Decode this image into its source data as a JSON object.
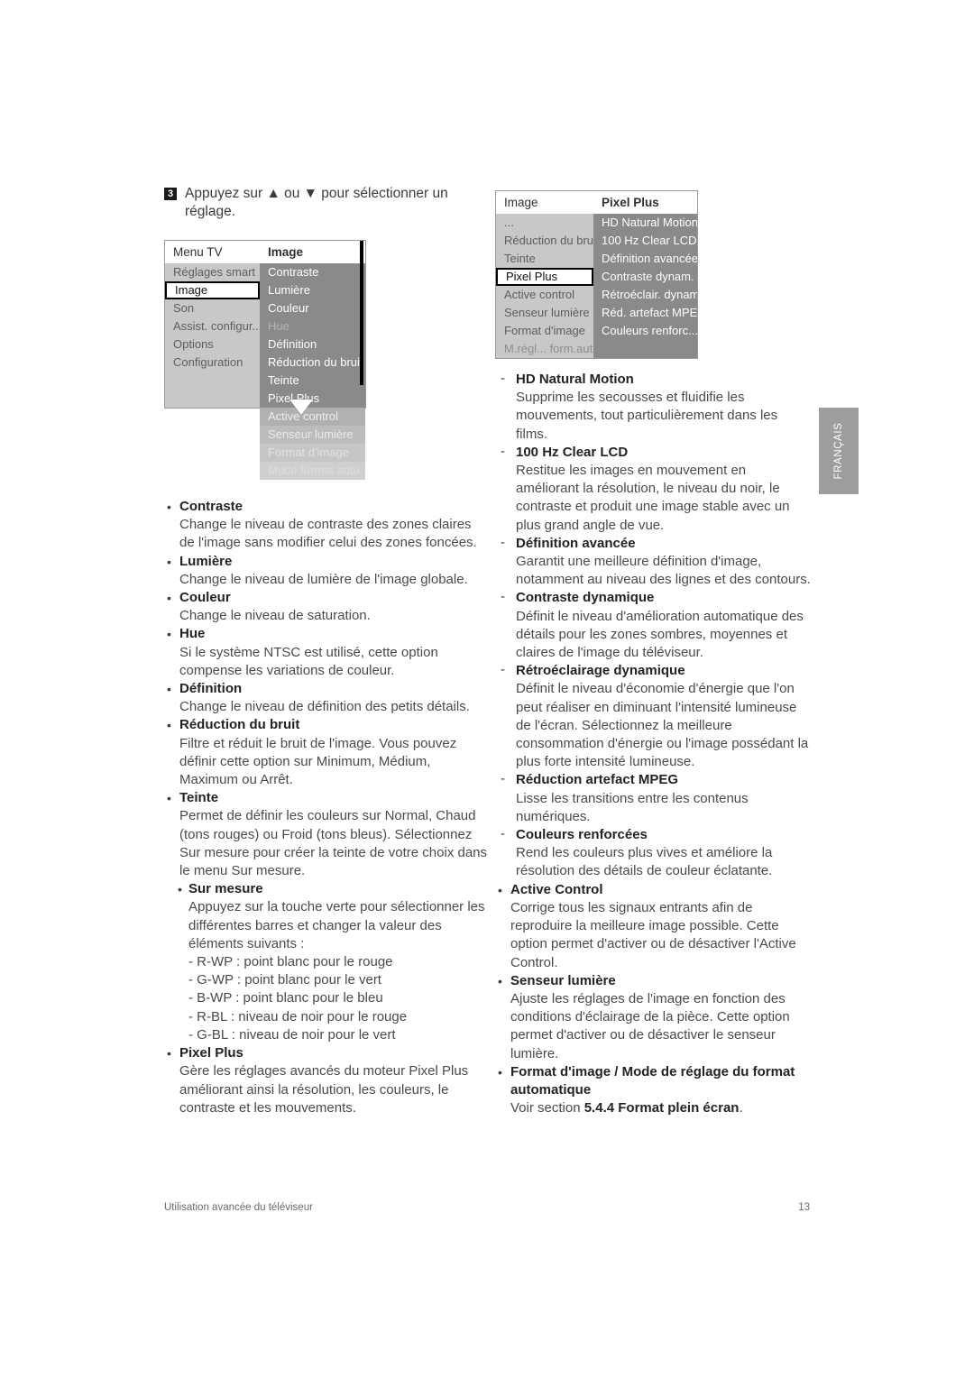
{
  "step": {
    "number": "3",
    "text": "Appuyez sur ▲ ou ▼ pour sélectionner un réglage."
  },
  "menu_tv": {
    "header_left": "Menu TV",
    "header_right": "Image",
    "left_items": [
      {
        "label": "Réglages smart",
        "state": "normal"
      },
      {
        "label": "Image",
        "state": "selected"
      },
      {
        "label": "Son",
        "state": "normal"
      },
      {
        "label": "Assist. configur...",
        "state": "normal"
      },
      {
        "label": "Options",
        "state": "normal"
      },
      {
        "label": "Configuration",
        "state": "normal"
      },
      {
        "label": "",
        "state": "blank"
      },
      {
        "label": "",
        "state": "blank"
      }
    ],
    "right_items": [
      {
        "label": "Contraste",
        "state": "normal"
      },
      {
        "label": "Lumière",
        "state": "normal"
      },
      {
        "label": "Couleur",
        "state": "normal"
      },
      {
        "label": "Hue",
        "state": "dim"
      },
      {
        "label": "Définition",
        "state": "normal"
      },
      {
        "label": "Réduction du bruit",
        "state": "normal"
      },
      {
        "label": "Teinte",
        "state": "normal"
      },
      {
        "label": "Pixel Plus",
        "state": "normal"
      },
      {
        "label": "Active control",
        "state": "fade1"
      },
      {
        "label": "Senseur lumière",
        "state": "fade2"
      },
      {
        "label": "Format d'image",
        "state": "fade3"
      },
      {
        "label": "Mode format auto...",
        "state": "fade4"
      }
    ]
  },
  "menu_pixelplus": {
    "header_left": "Image",
    "header_right": "Pixel Plus",
    "left_items": [
      {
        "label": "...",
        "state": "normal"
      },
      {
        "label": "Réduction du bruit",
        "state": "normal"
      },
      {
        "label": "Teinte",
        "state": "normal"
      },
      {
        "label": "Pixel Plus",
        "state": "selected"
      },
      {
        "label": "Active control",
        "state": "normal"
      },
      {
        "label": "Senseur lumière",
        "state": "normal"
      },
      {
        "label": "Format d'image",
        "state": "normal"
      },
      {
        "label": "M.régl... form.auto...",
        "state": "dim"
      }
    ],
    "right_items": [
      {
        "label": "HD Natural Motion",
        "state": "normal"
      },
      {
        "label": "100 Hz Clear LCD",
        "state": "normal"
      },
      {
        "label": "Définition avancée",
        "state": "normal"
      },
      {
        "label": "Contraste dynam.",
        "state": "normal"
      },
      {
        "label": "Rétroéclair. dynam.",
        "state": "normal"
      },
      {
        "label": "Réd. artefact MPEG",
        "state": "normal"
      },
      {
        "label": "Couleurs renforc...",
        "state": "normal"
      },
      {
        "label": "",
        "state": "empty"
      }
    ]
  },
  "left_column": {
    "items": [
      {
        "title": "Contraste",
        "body": "Change le niveau de contraste des zones claires de l'image sans modifier celui des zones foncées."
      },
      {
        "title": "Lumière",
        "body": "Change le niveau de lumière de l'image globale."
      },
      {
        "title": "Couleur",
        "body": "Change le niveau de saturation."
      },
      {
        "title": "Hue",
        "body": "Si le système NTSC est utilisé, cette option compense les variations de couleur."
      },
      {
        "title": "Définition",
        "body": "Change le niveau de définition des petits détails."
      },
      {
        "title": "Réduction du bruit",
        "body": "Filtre et réduit le bruit de l'image. Vous pouvez définir cette option sur Minimum, Médium, Maximum ou Arrêt."
      },
      {
        "title": "Teinte",
        "body": "Permet de définir les couleurs sur Normal, Chaud (tons rouges) ou Froid (tons bleus). Sélectionnez Sur mesure pour créer la teinte de votre choix dans le menu Sur mesure."
      }
    ],
    "sub_item": {
      "title": "Sur mesure",
      "body": "Appuyez sur la touche verte pour sélectionner les différentes barres et changer la valeur des éléments suivants :",
      "dash_lines": [
        "- R-WP : point blanc pour le rouge",
        "- G-WP : point blanc pour le vert",
        "- B-WP : point blanc pour le bleu",
        "- R-BL : niveau de noir pour le rouge",
        "- G-BL : niveau de noir pour le vert"
      ]
    },
    "last_item": {
      "title": "Pixel Plus",
      "body": "Gère les réglages avancés du moteur Pixel Plus améliorant ainsi la résolution, les couleurs, le contraste et les mouvements."
    }
  },
  "right_column": {
    "dash_items": [
      {
        "title": "HD Natural Motion",
        "body": "Supprime les secousses et fluidifie les mouvements, tout particulièrement dans les films."
      },
      {
        "title": "100 Hz Clear LCD",
        "body": "Restitue les images en mouvement en améliorant la résolution, le niveau du noir, le contraste et produit une image stable avec un plus grand angle de vue."
      },
      {
        "title": "Définition avancée",
        "body": "Garantit une meilleure définition d'image, notamment au niveau des lignes et des contours."
      },
      {
        "title": "Contraste dynamique",
        "body": "Définit le niveau d'amélioration automatique des détails pour les zones sombres, moyennes et claires de l'image du téléviseur."
      },
      {
        "title": "Rétroéclairage dynamique",
        "body": "Définit le niveau d'économie d'énergie que l'on peut réaliser en diminuant l'intensité lumineuse de l'écran. Sélectionnez la meilleure consommation d'énergie ou l'image possédant la plus forte intensité lumineuse."
      },
      {
        "title": "Réduction artefact MPEG",
        "body": "Lisse les transitions entre les contenus numériques."
      },
      {
        "title": "Couleurs renforcées",
        "body": "Rend les couleurs plus vives et améliore la résolution des détails de couleur éclatante."
      }
    ],
    "bullet_items": [
      {
        "title": "Active Control",
        "body": "Corrige tous les signaux entrants afin de reproduire la meilleure image possible. Cette option permet d'activer ou de désactiver l'Active Control."
      },
      {
        "title": "Senseur lumière",
        "body": "Ajuste les réglages de l'image en fonction des conditions d'éclairage de la pièce. Cette option permet d'activer ou de désactiver le senseur lumière."
      }
    ],
    "last_bullet": {
      "title": "Format d'image / Mode de réglage du format automatique",
      "body_prefix": "Voir section ",
      "body_strong": "5.4.4 Format plein écran",
      "body_suffix": "."
    }
  },
  "language_tab": {
    "label": "FRANÇAIS"
  },
  "footer": {
    "left": "Utilisation avancée du téléviseur",
    "page": "13"
  }
}
